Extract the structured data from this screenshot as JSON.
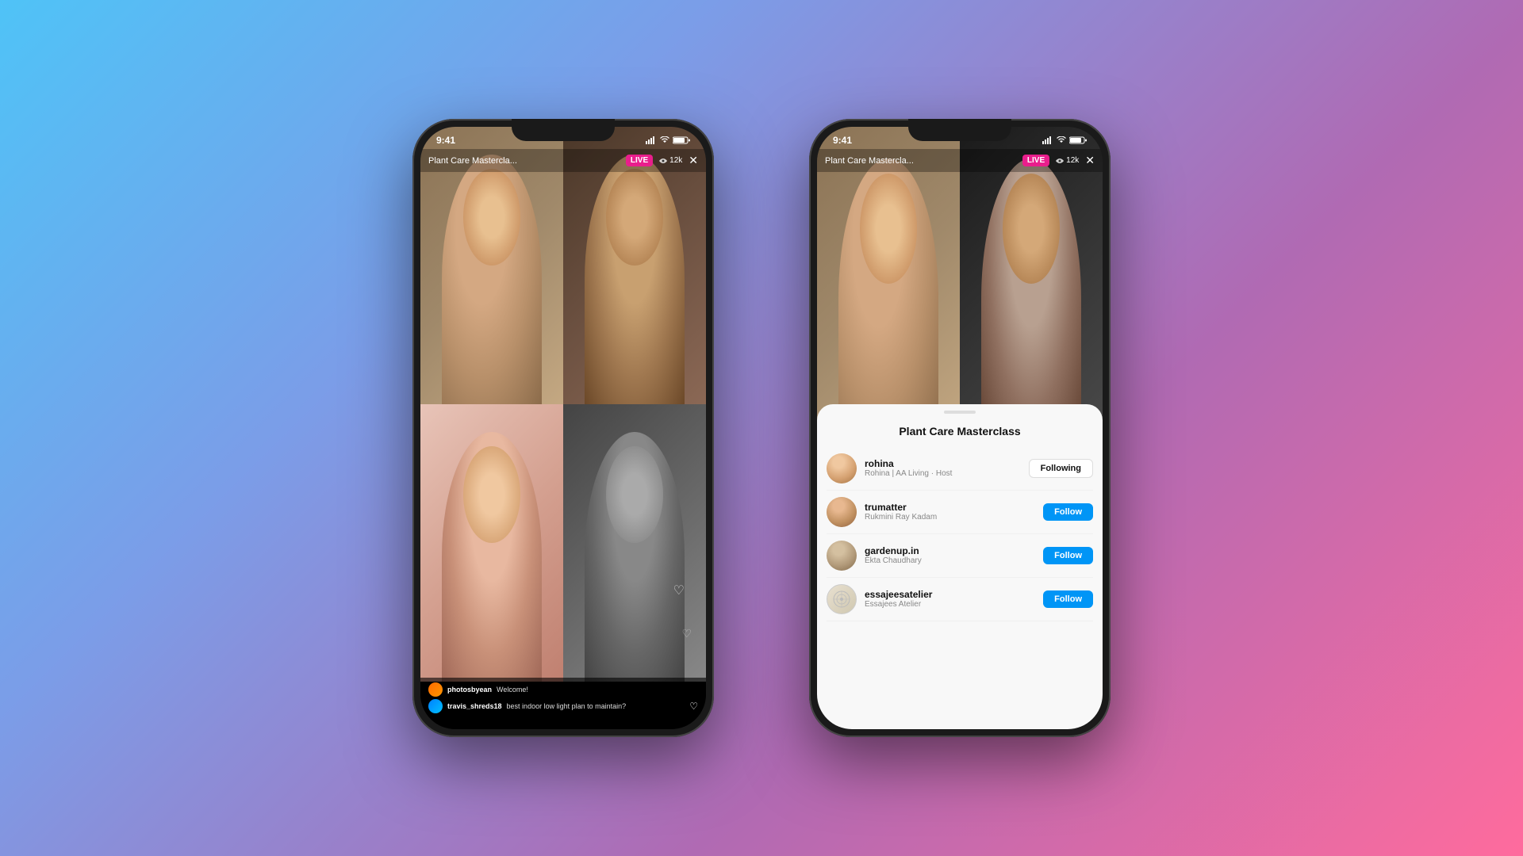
{
  "background": "gradient purple pink blue",
  "phone1": {
    "status_time": "9:41",
    "live_title": "Plant Care Mastercla...",
    "live_badge": "LIVE",
    "viewer_count": "12k",
    "chat_messages": [
      {
        "username": "photosbyean",
        "text": "Welcome!",
        "avatar_color": "orange"
      },
      {
        "username": "travis_shreds18",
        "text": "best indoor low light plan to maintain?",
        "avatar_color": "blue"
      }
    ]
  },
  "phone2": {
    "status_time": "9:41",
    "live_title": "Plant Care Mastercla...",
    "live_badge": "LIVE",
    "viewer_count": "12k",
    "panel_title": "Plant Care Masterclass",
    "users": [
      {
        "username": "rohina",
        "subtitle": "Rohina | AA Living · Host",
        "button_label": "Following",
        "button_type": "following"
      },
      {
        "username": "trumatter",
        "subtitle": "Rukmini Ray Kadam",
        "button_label": "Follow",
        "button_type": "follow"
      },
      {
        "username": "gardenup.in",
        "subtitle": "Ekta Chaudhary",
        "button_label": "Follow",
        "button_type": "follow"
      },
      {
        "username": "essajeesatelier",
        "subtitle": "Essajees Atelier",
        "button_label": "Follow",
        "button_type": "follow"
      }
    ]
  }
}
